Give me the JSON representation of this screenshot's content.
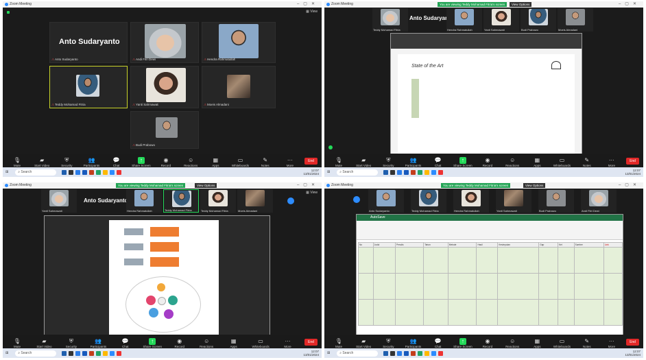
{
  "window_title": "Zoom Meeting",
  "view_label": "View",
  "screen_share_banner": "You are viewing Teddy Mohamad Fitria's screen",
  "view_options": "View Options",
  "q1": {
    "big_name": "Anto Sudaryanto",
    "tiles": [
      "Anto Sudaryanto",
      "Andi Fitri Dewi",
      "Hendra Rahmatullah",
      "Teddy Mohamad Fitria",
      "Yanti Sahmawati",
      "Moeis Almadani",
      "Budi Prabowo"
    ]
  },
  "q2": {
    "strip": [
      "Teddy Mohamad Fitria",
      "Anto Sudaryanto",
      "Hendra Rahmatullah",
      "Yanti Sahmawati",
      "Budi Prabowo",
      "Moeis Almadani"
    ],
    "slide_title": "State of the Art"
  },
  "q3": {
    "big_name": "Anto Sudaryanto",
    "strip": [
      "Yanti Sahmawati",
      "Hendra Rahmatullah",
      "Teddy Mohamad Fitria",
      "Moeis Almadani"
    ]
  },
  "q4": {
    "strip": [
      "Anto Sudaryanto",
      "Teddy Mohamad Fitria",
      "Hendra Rahmatullah",
      "Yanti Sahmawati",
      "Budi Prabowo",
      "Andi Fitri Dewi"
    ],
    "excel_title": "AutoSave",
    "sheet_headers": [
      "No",
      "Judul",
      "Penulis",
      "Tahun",
      "Metode",
      "Hasil",
      "Kesimpulan",
      "Gap",
      "Ket",
      "Sumber",
      "Link"
    ]
  },
  "toolbar": {
    "mute": "Mute",
    "video": "Start Video",
    "security": "Security",
    "participants": "Participants",
    "chat": "Chat",
    "share": "Share Screen",
    "record": "Record",
    "reactions": "Reactions",
    "apps": "Apps",
    "whiteboards": "Whiteboards",
    "notes": "Notes",
    "more": "More",
    "end": "End"
  },
  "taskbar": {
    "search": "Search",
    "time": "12:07",
    "date": "13/01/2024"
  }
}
